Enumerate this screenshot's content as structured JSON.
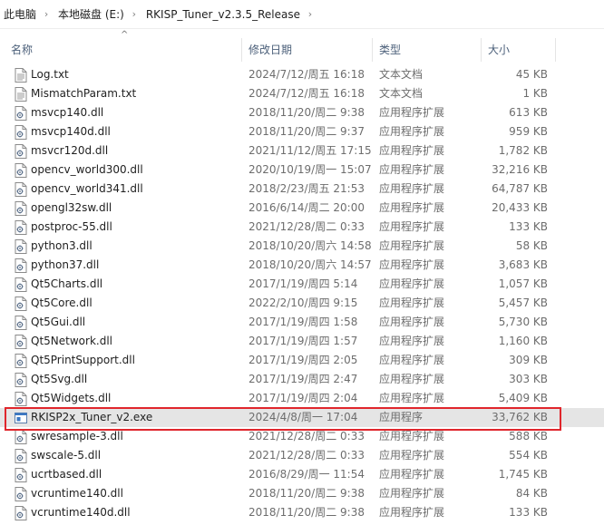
{
  "breadcrumb": [
    "此电脑",
    "本地磁盘 (E:)",
    "RKISP_Tuner_v2.3.5_Release"
  ],
  "columns": {
    "name": "名称",
    "date": "修改日期",
    "type": "类型",
    "size": "大小"
  },
  "files": [
    {
      "name": "Log.txt",
      "date": "2024/7/12/周五 16:18",
      "type": "文本文档",
      "size": "45 KB",
      "icon": "text-file-icon"
    },
    {
      "name": "MismatchParam.txt",
      "date": "2024/7/12/周五 16:18",
      "type": "文本文档",
      "size": "1 KB",
      "icon": "text-file-icon"
    },
    {
      "name": "msvcp140.dll",
      "date": "2018/11/20/周二 9:38",
      "type": "应用程序扩展",
      "size": "613 KB",
      "icon": "dll-file-icon"
    },
    {
      "name": "msvcp140d.dll",
      "date": "2018/11/20/周二 9:37",
      "type": "应用程序扩展",
      "size": "959 KB",
      "icon": "dll-file-icon"
    },
    {
      "name": "msvcr120d.dll",
      "date": "2021/11/12/周五 17:15",
      "type": "应用程序扩展",
      "size": "1,782 KB",
      "icon": "dll-file-icon"
    },
    {
      "name": "opencv_world300.dll",
      "date": "2020/10/19/周一 15:07",
      "type": "应用程序扩展",
      "size": "32,216 KB",
      "icon": "dll-file-icon"
    },
    {
      "name": "opencv_world341.dll",
      "date": "2018/2/23/周五 21:53",
      "type": "应用程序扩展",
      "size": "64,787 KB",
      "icon": "dll-file-icon"
    },
    {
      "name": "opengl32sw.dll",
      "date": "2016/6/14/周二 20:00",
      "type": "应用程序扩展",
      "size": "20,433 KB",
      "icon": "dll-file-icon"
    },
    {
      "name": "postproc-55.dll",
      "date": "2021/12/28/周二 0:33",
      "type": "应用程序扩展",
      "size": "133 KB",
      "icon": "dll-file-icon"
    },
    {
      "name": "python3.dll",
      "date": "2018/10/20/周六 14:58",
      "type": "应用程序扩展",
      "size": "58 KB",
      "icon": "dll-file-icon"
    },
    {
      "name": "python37.dll",
      "date": "2018/10/20/周六 14:57",
      "type": "应用程序扩展",
      "size": "3,683 KB",
      "icon": "dll-file-icon"
    },
    {
      "name": "Qt5Charts.dll",
      "date": "2017/1/19/周四 5:14",
      "type": "应用程序扩展",
      "size": "1,057 KB",
      "icon": "dll-file-icon"
    },
    {
      "name": "Qt5Core.dll",
      "date": "2022/2/10/周四 9:15",
      "type": "应用程序扩展",
      "size": "5,457 KB",
      "icon": "dll-file-icon"
    },
    {
      "name": "Qt5Gui.dll",
      "date": "2017/1/19/周四 1:58",
      "type": "应用程序扩展",
      "size": "5,730 KB",
      "icon": "dll-file-icon"
    },
    {
      "name": "Qt5Network.dll",
      "date": "2017/1/19/周四 1:57",
      "type": "应用程序扩展",
      "size": "1,160 KB",
      "icon": "dll-file-icon"
    },
    {
      "name": "Qt5PrintSupport.dll",
      "date": "2017/1/19/周四 2:05",
      "type": "应用程序扩展",
      "size": "309 KB",
      "icon": "dll-file-icon"
    },
    {
      "name": "Qt5Svg.dll",
      "date": "2017/1/19/周四 2:47",
      "type": "应用程序扩展",
      "size": "303 KB",
      "icon": "dll-file-icon"
    },
    {
      "name": "Qt5Widgets.dll",
      "date": "2017/1/19/周四 2:04",
      "type": "应用程序扩展",
      "size": "5,409 KB",
      "icon": "dll-file-icon"
    },
    {
      "name": "RKISP2x_Tuner_v2.exe",
      "date": "2024/4/8/周一 17:04",
      "type": "应用程序",
      "size": "33,762 KB",
      "icon": "exe-file-icon",
      "highlighted": true
    },
    {
      "name": "swresample-3.dll",
      "date": "2021/12/28/周二 0:33",
      "type": "应用程序扩展",
      "size": "588 KB",
      "icon": "dll-file-icon"
    },
    {
      "name": "swscale-5.dll",
      "date": "2021/12/28/周二 0:33",
      "type": "应用程序扩展",
      "size": "554 KB",
      "icon": "dll-file-icon"
    },
    {
      "name": "ucrtbased.dll",
      "date": "2016/8/29/周一 11:54",
      "type": "应用程序扩展",
      "size": "1,745 KB",
      "icon": "dll-file-icon"
    },
    {
      "name": "vcruntime140.dll",
      "date": "2018/11/20/周二 9:38",
      "type": "应用程序扩展",
      "size": "84 KB",
      "icon": "dll-file-icon"
    },
    {
      "name": "vcruntime140d.dll",
      "date": "2018/11/20/周二 9:38",
      "type": "应用程序扩展",
      "size": "133 KB",
      "icon": "dll-file-icon"
    }
  ],
  "colors": {
    "highlight_row": "#e5e5e5",
    "annotation_box": "#e0262c",
    "header_text": "#4c607a"
  }
}
